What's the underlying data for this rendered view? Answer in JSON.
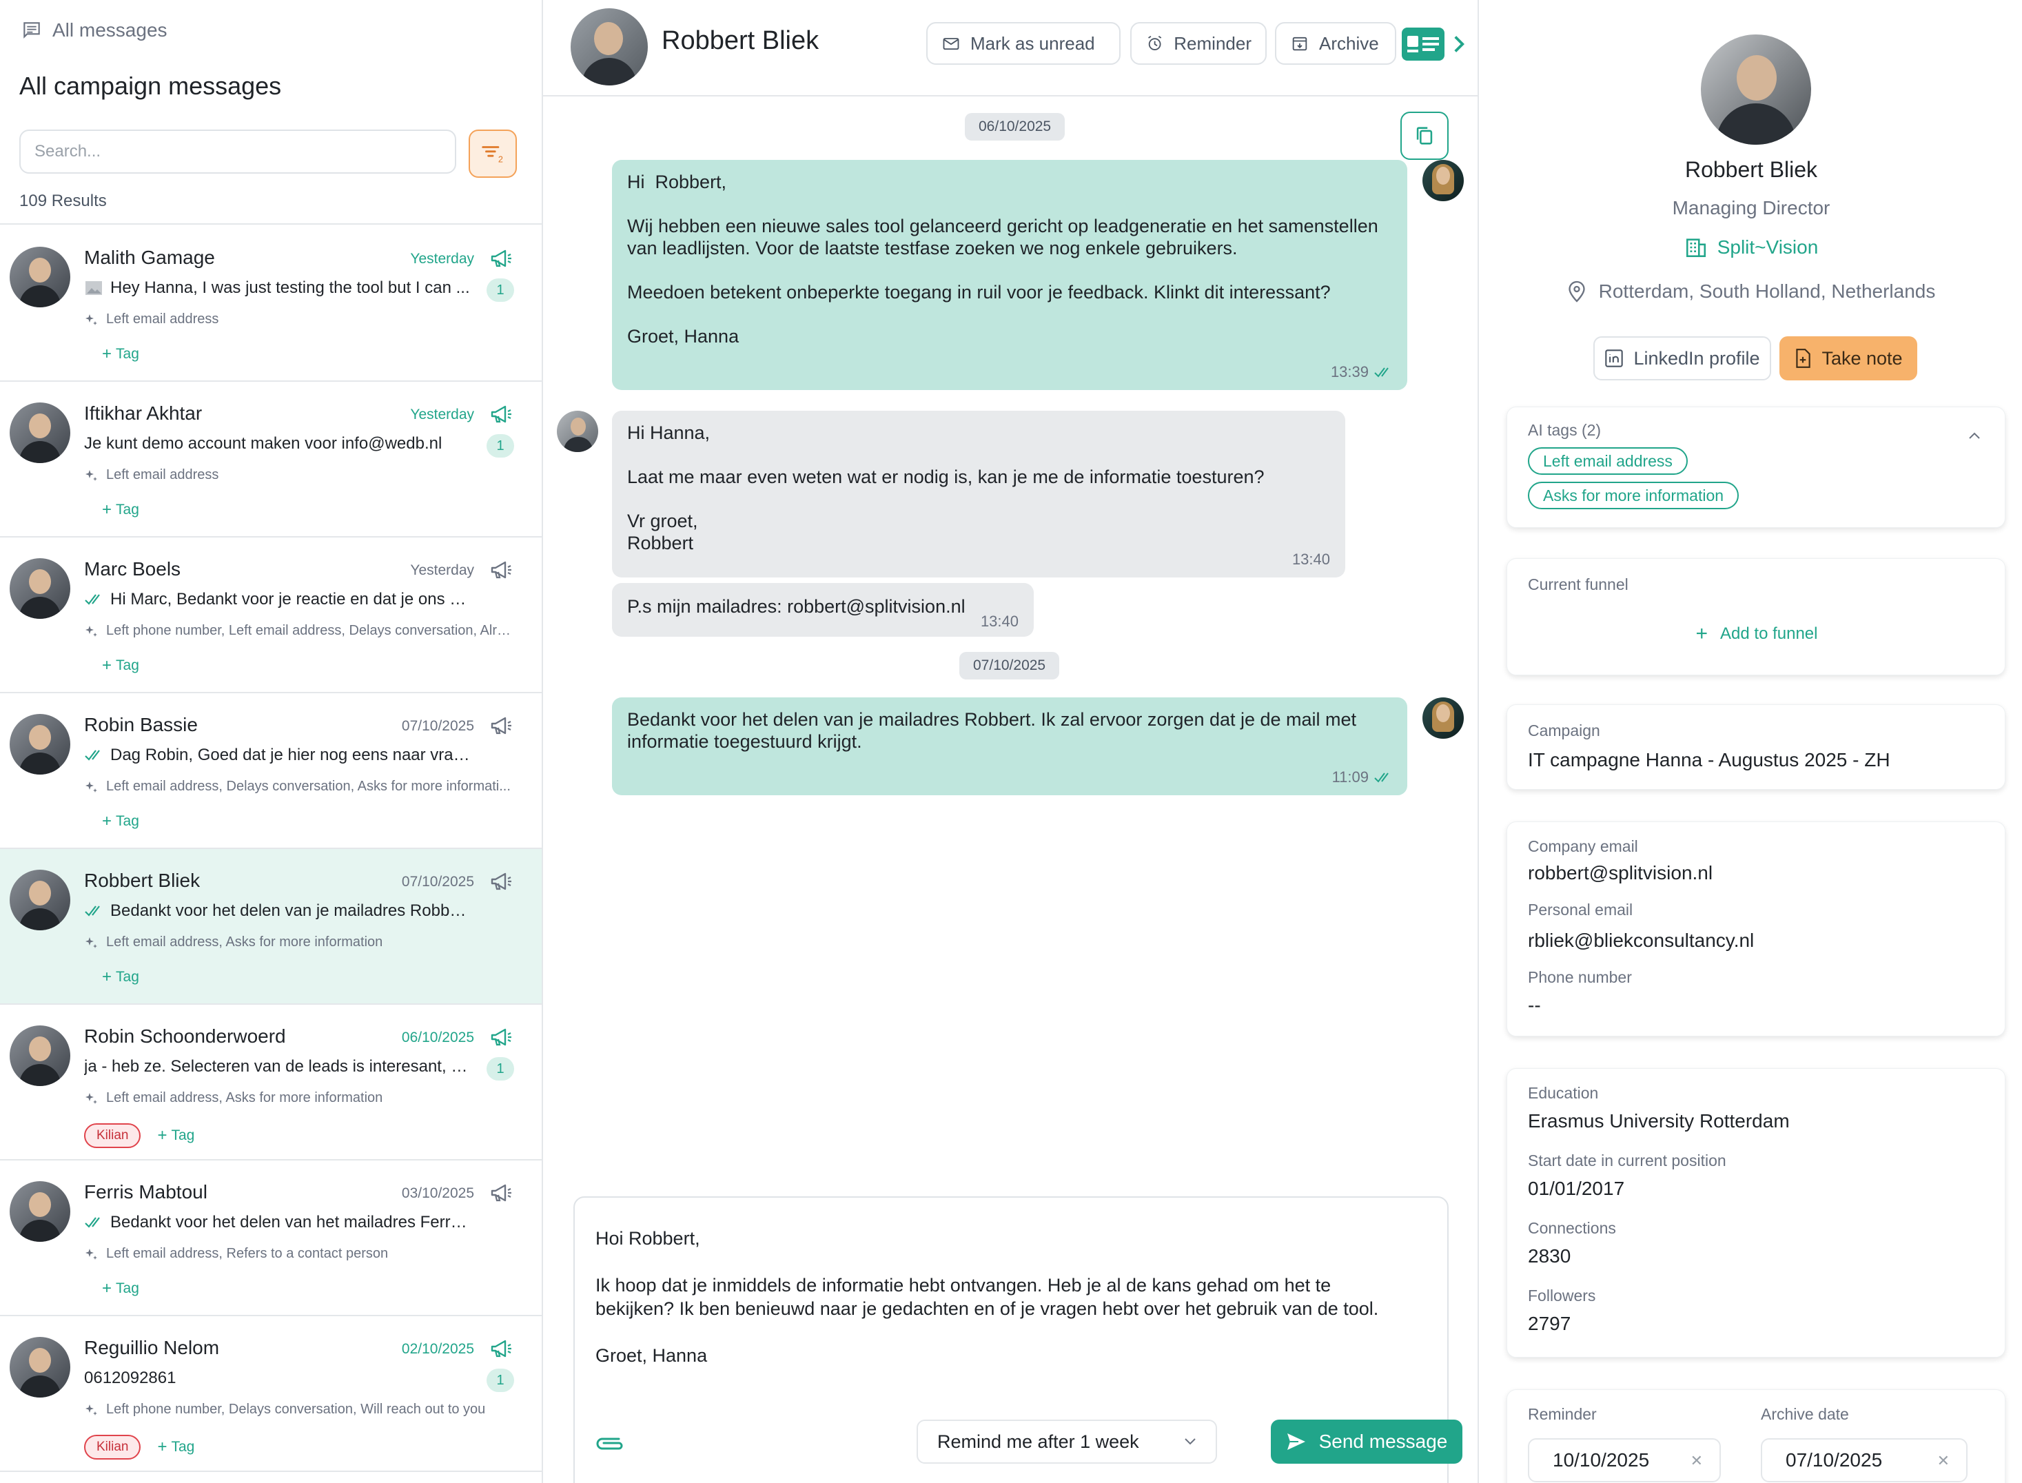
{
  "left": {
    "crumb": "All messages",
    "title": "All campaign messages",
    "search_placeholder": "Search...",
    "filter_count": "2",
    "results": "109  Results",
    "add_tag_label": "Tag",
    "items": [
      {
        "name": "Malith Gamage",
        "date": "Yesterday",
        "date_green": true,
        "preview": "Hey Hanna, I was just testing the tool but I can ...",
        "preview_icon": "image-icon",
        "badge": "1",
        "ai_tags": "Left email address",
        "tags": []
      },
      {
        "name": "Iftikhar Akhtar",
        "date": "Yesterday",
        "date_green": true,
        "preview": "Je kunt demo account maken voor info@wedb.nl",
        "preview_icon": "",
        "badge": "1",
        "ai_tags": "Left email address",
        "tags": []
      },
      {
        "name": "Marc Boels",
        "date": "Yesterday",
        "date_green": false,
        "preview": "Hi Marc, Bedankt voor je reactie en dat je ons op je lij...",
        "preview_icon": "double-check-icon",
        "badge": "",
        "ai_tags": "Left phone number, Left email address, Delays conversation, Alre...",
        "tags": []
      },
      {
        "name": "Robin Bassie",
        "date": "07/10/2025",
        "date_green": false,
        "preview": "Dag Robin, Goed dat je hier nog eens naar vraagt. Beg...",
        "preview_icon": "double-check-icon",
        "badge": "",
        "ai_tags": "Left email address, Delays conversation, Asks for more informati...",
        "tags": []
      },
      {
        "name": "Robbert Bliek",
        "date": "07/10/2025",
        "date_green": false,
        "preview": "Bedankt voor het delen van je mailadres Robbert. Ik z...",
        "preview_icon": "double-check-icon",
        "badge": "",
        "ai_tags": "Left email address, Asks for more information",
        "tags": [],
        "active": true
      },
      {
        "name": "Robin Schoonderwoerd",
        "date": "06/10/2025",
        "date_green": true,
        "preview": "ja - heb ze. Selecteren van de leads is interesant, m...",
        "preview_icon": "",
        "badge": "1",
        "ai_tags": "Left email address, Asks for more information",
        "tags": [
          "Kilian"
        ]
      },
      {
        "name": "Ferris Mabtoul",
        "date": "03/10/2025",
        "date_green": false,
        "preview": "Bedankt voor het delen van het mailadres Ferris. Ik he...",
        "preview_icon": "double-check-icon",
        "badge": "",
        "ai_tags": "Left email address, Refers to a contact person",
        "tags": []
      },
      {
        "name": "Reguillio Nelom",
        "date": "02/10/2025",
        "date_green": true,
        "preview": "0612092861",
        "preview_icon": "",
        "badge": "1",
        "ai_tags": "Left phone number, Delays conversation, Will reach out to you",
        "tags": [
          "Kilian"
        ]
      }
    ]
  },
  "header": {
    "name": "Robbert Bliek",
    "mark_unread": "Mark as unread",
    "reminder": "Reminder",
    "archive": "Archive"
  },
  "chat": {
    "date1": "06/10/2025",
    "date2": "07/10/2025",
    "msg1": "Hi  Robbert,\n\nWij hebben een nieuwe sales tool gelanceerd gericht op leadgeneratie en het samenstellen van leadlijsten. Voor de laatste testfase zoeken we nog enkele gebruikers.\n\nMeedoen betekent onbeperkte toegang in ruil voor je feedback. Klinkt dit interessant?\n\nGroet, Hanna",
    "msg1_time": "13:39",
    "msg2": "Hi Hanna,\n\nLaat me maar even weten wat er nodig is, kan je me de informatie toesturen?\n\nVr groet,\nRobbert",
    "msg2_time": "13:40",
    "msg3": "P.s mijn mailadres: robbert@splitvision.nl",
    "msg3_time": "13:40",
    "msg4": "Bedankt voor het delen van je mailadres Robbert. Ik zal ervoor zorgen dat je de mail met informatie toegestuurd krijgt.",
    "msg4_time": "11:09"
  },
  "composer": {
    "draft": "Hoi Robbert,\n\nIk hoop dat je inmiddels de informatie hebt ontvangen. Heb je al de kans gehad om het te bekijken? Ik ben benieuwd naar je gedachten en of je vragen hebt over het gebruik van de tool.\n\nGroet, Hanna",
    "remind": "Remind me after 1 week",
    "send": "Send message"
  },
  "profile": {
    "name": "Robbert Bliek",
    "role": "Managing Director",
    "company": "Split~Vision",
    "location": "Rotterdam, South Holland, Netherlands",
    "linkedin": "LinkedIn profile",
    "take_note": "Take note",
    "ai_tags_label": "AI tags  (2)",
    "ai_tags": [
      "Left email address",
      "Asks for more information"
    ],
    "funnel_label": "Current funnel",
    "add_funnel": "Add to funnel",
    "campaign_label": "Campaign",
    "campaign": "IT campagne Hanna - Augustus 2025 - ZH",
    "company_email_label": "Company email",
    "company_email": "robbert@splitvision.nl",
    "personal_email_label": "Personal email",
    "personal_email": "rbliek@bliekconsultancy.nl",
    "phone_label": "Phone number",
    "phone": "--",
    "education_label": "Education",
    "education": "Erasmus University Rotterdam",
    "start_label": "Start date in current position",
    "start": "01/01/2017",
    "connections_label": "Connections",
    "connections": "2830",
    "followers_label": "Followers",
    "followers": "2797",
    "reminder_label": "Reminder",
    "reminder_date": "10/10/2025",
    "archive_label": "Archive date",
    "archive_date": "07/10/2025"
  },
  "colors": {
    "accent": "#21a58a",
    "outgoing_bubble": "#bfe6dd",
    "incoming_bubble": "#e8eaec",
    "note_button": "#f7b26b",
    "tag_red": "#e0434b"
  }
}
